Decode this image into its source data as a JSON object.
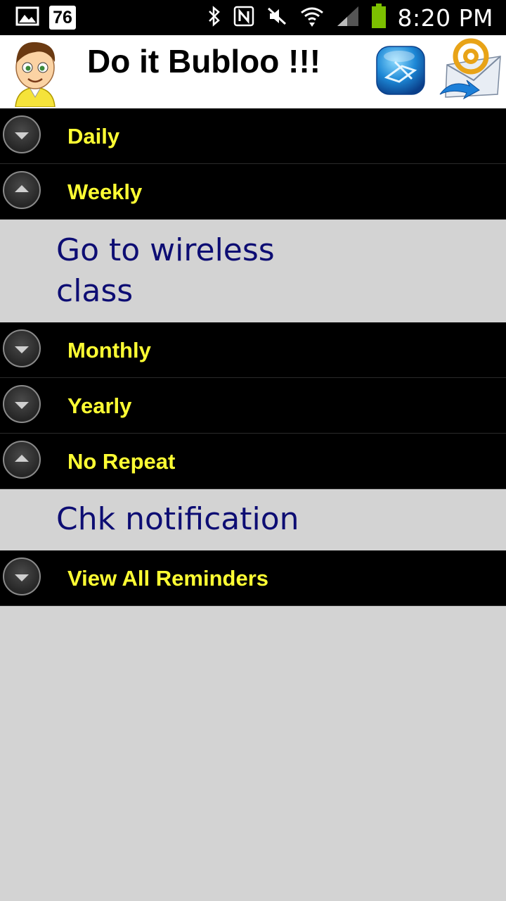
{
  "status_bar": {
    "notification_count": "76",
    "time": "8:20 PM",
    "icons": [
      "gallery-icon",
      "bluetooth-icon",
      "nfc-icon",
      "mute-icon",
      "wifi-icon",
      "signal-icon",
      "battery-icon"
    ],
    "battery_color": "#7cc000"
  },
  "header": {
    "title": "Do it Bubloo !!!",
    "avatar": "boy-avatar",
    "buttons": [
      "edit-note-icon",
      "email-icon"
    ]
  },
  "list": {
    "items": [
      {
        "type": "category",
        "label": "Daily",
        "state": "collapsed"
      },
      {
        "type": "category",
        "label": "Weekly",
        "state": "expanded"
      },
      {
        "type": "reminder",
        "text": "Go to wireless class"
      },
      {
        "type": "category",
        "label": "Monthly",
        "state": "collapsed"
      },
      {
        "type": "category",
        "label": "Yearly",
        "state": "collapsed"
      },
      {
        "type": "category",
        "label": "No Repeat",
        "state": "expanded"
      },
      {
        "type": "reminder",
        "text": "Chk notification"
      },
      {
        "type": "category",
        "label": "View All Reminders",
        "state": "collapsed"
      }
    ]
  },
  "colors": {
    "category_bg": "#000000",
    "category_text": "#ffff33",
    "reminder_text": "#0d0d73",
    "background": "#d3d3d3"
  }
}
